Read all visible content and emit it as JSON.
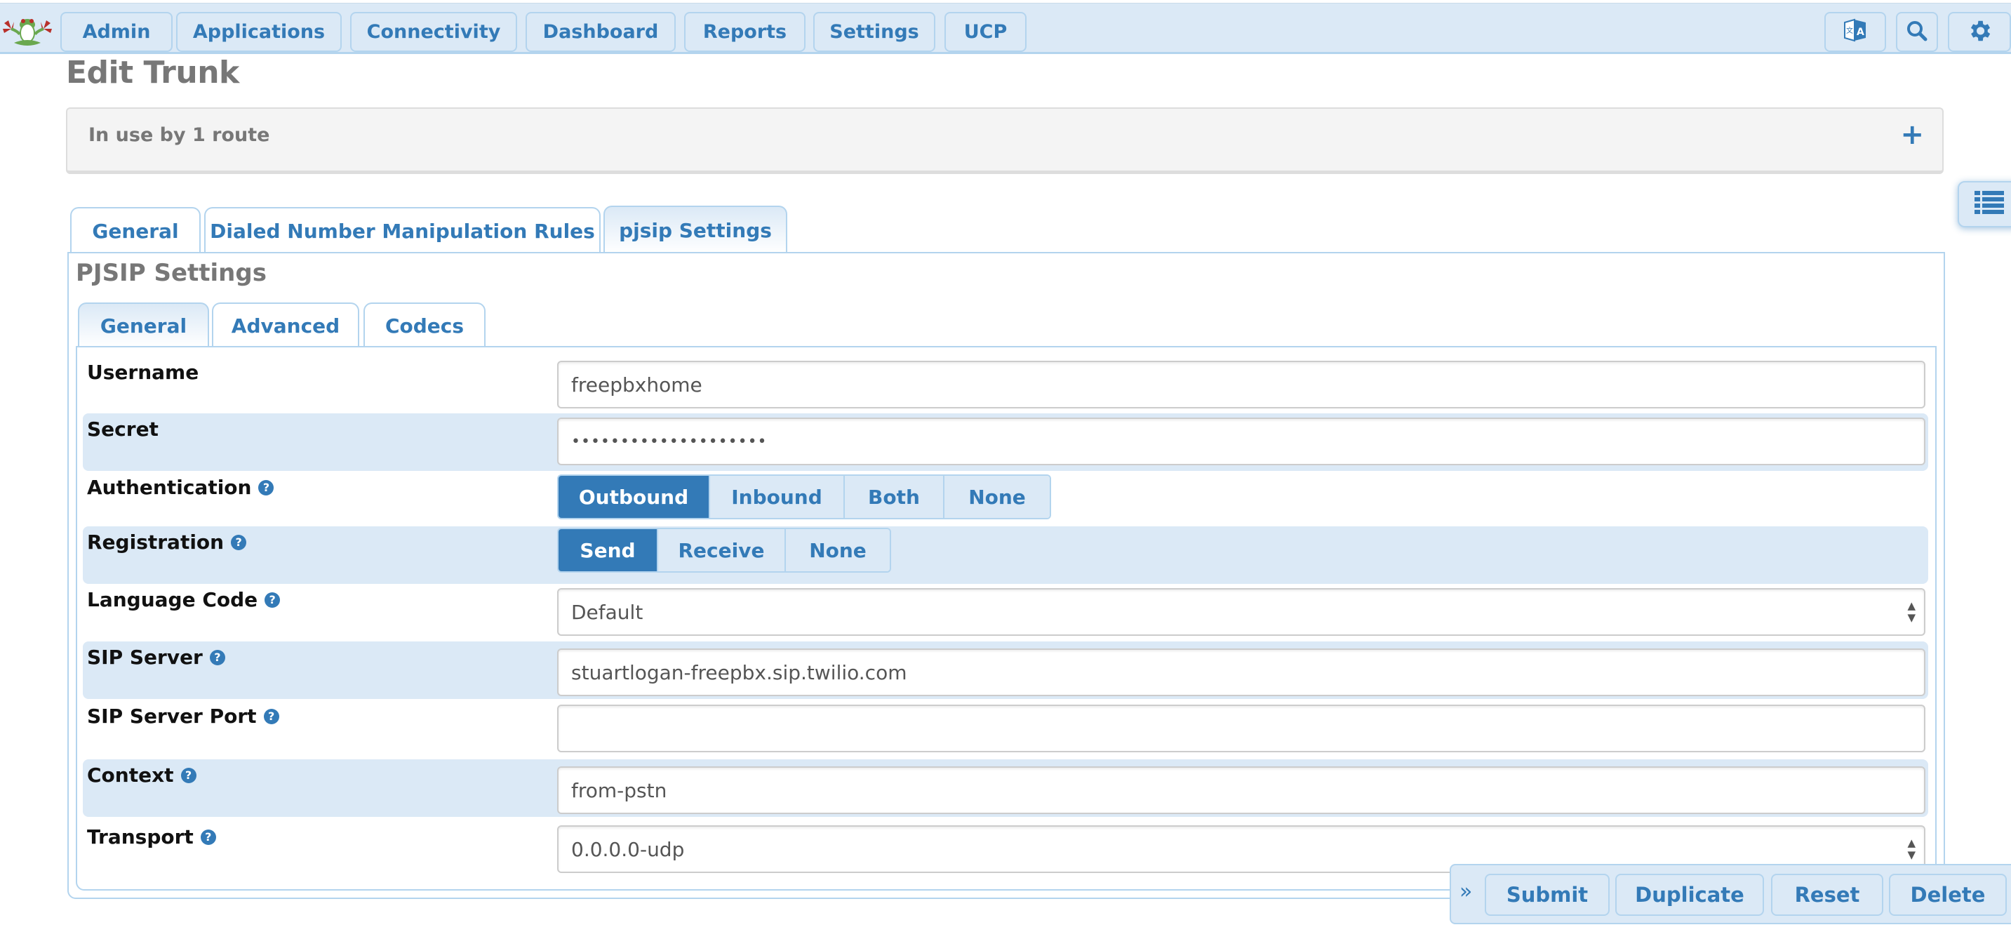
{
  "topbar": {
    "logo": "freepbx-frog-logo",
    "nav": [
      {
        "label": "Admin"
      },
      {
        "label": "Applications"
      },
      {
        "label": "Connectivity"
      },
      {
        "label": "Dashboard"
      },
      {
        "label": "Reports"
      },
      {
        "label": "Settings"
      },
      {
        "label": "UCP"
      }
    ],
    "icons": [
      "language-translate-icon",
      "search-icon",
      "gear-icon"
    ]
  },
  "page": {
    "title": "Edit Trunk",
    "info_panel": {
      "text": "In use by 1 route",
      "expand_symbol": "+"
    }
  },
  "outer_tabs": [
    {
      "label": "General",
      "active": false
    },
    {
      "label": "Dialed Number Manipulation Rules",
      "active": false
    },
    {
      "label": "pjsip Settings",
      "active": true
    }
  ],
  "section": {
    "title": "PJSIP Settings",
    "inner_tabs": [
      {
        "label": "General",
        "active": true
      },
      {
        "label": "Advanced",
        "active": false
      },
      {
        "label": "Codecs",
        "active": false
      }
    ]
  },
  "form": {
    "username": {
      "label": "Username",
      "value": "freepbxhome"
    },
    "secret": {
      "label": "Secret",
      "value": "••••••••••••••••••••"
    },
    "authentication": {
      "label": "Authentication",
      "options": [
        "Outbound",
        "Inbound",
        "Both",
        "None"
      ],
      "selected": "Outbound"
    },
    "registration": {
      "label": "Registration",
      "options": [
        "Send",
        "Receive",
        "None"
      ],
      "selected": "Send"
    },
    "language_code": {
      "label": "Language Code",
      "value": "Default"
    },
    "sip_server": {
      "label": "SIP Server",
      "value": "stuartlogan-freepbx.sip.twilio.com"
    },
    "sip_server_port": {
      "label": "SIP Server Port",
      "value": ""
    },
    "context": {
      "label": "Context",
      "value": "from-pstn"
    },
    "transport": {
      "label": "Transport",
      "value": "0.0.0.0-udp"
    },
    "help_symbol": "?"
  },
  "actions": {
    "collapse_symbol": "»",
    "submit": "Submit",
    "duplicate": "Duplicate",
    "reset": "Reset",
    "delete": "Delete"
  },
  "colors": {
    "accent": "#337ab7",
    "bar_bg": "#dbe9f6",
    "bar_border": "#b3d4ee",
    "title_gray": "#777777"
  }
}
